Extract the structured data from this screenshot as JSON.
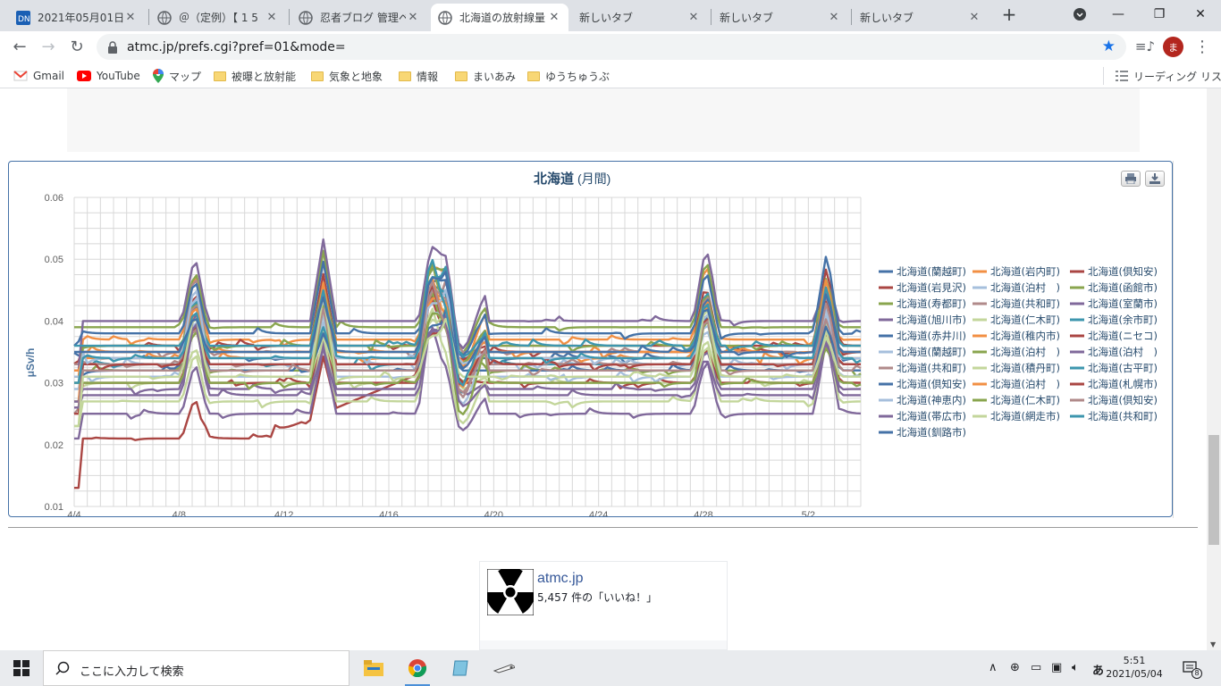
{
  "browser": {
    "tabs": [
      {
        "title": "2021年05月01日の",
        "favicon": "dn-icon",
        "active": false
      },
      {
        "title": "＠（定例）【 1 5",
        "favicon": "globe-icon",
        "active": false
      },
      {
        "title": "忍者ブログ 管理ペー",
        "favicon": "globe-icon",
        "active": false
      },
      {
        "title": "北海道の放射線量",
        "favicon": "globe-icon",
        "active": true
      },
      {
        "title": "新しいタブ",
        "favicon": "",
        "active": false
      },
      {
        "title": "新しいタブ",
        "favicon": "",
        "active": false
      },
      {
        "title": "新しいタブ",
        "favicon": "",
        "active": false
      }
    ],
    "new_tab_label": "+",
    "url": "atmc.jp/prefs.cgi?pref=01&mode=",
    "profile_initial": "ま",
    "bookmarks": [
      {
        "label": "Gmail",
        "icon": "gmail-icon"
      },
      {
        "label": "YouTube",
        "icon": "youtube-icon"
      },
      {
        "label": "マップ",
        "icon": "maps-icon"
      },
      {
        "label": "被曝と放射能",
        "icon": "folder-icon"
      },
      {
        "label": "気象と地象",
        "icon": "folder-icon"
      },
      {
        "label": "情報",
        "icon": "folder-icon"
      },
      {
        "label": "まいあみ",
        "icon": "folder-icon"
      },
      {
        "label": "ゆうちゅうぶ",
        "icon": "folder-icon"
      }
    ],
    "reading_list": "リーディング リスト"
  },
  "chart_data": {
    "type": "line",
    "title": "北海道",
    "subtitle": "(月間)",
    "ylabel": "μSv/h",
    "ylim": [
      0.01,
      0.06
    ],
    "yticks": [
      "0.06",
      "0.05",
      "0.04",
      "0.03",
      "0.02",
      "0.01"
    ],
    "xticks": [
      "4/4",
      "4/8",
      "4/12",
      "4/16",
      "4/20",
      "4/24",
      "4/28",
      "5/2"
    ],
    "x_range_days": [
      0,
      30
    ],
    "legend_placement": "right",
    "series": [
      {
        "name": "北海道(蘭越町)",
        "color": "#4572a7",
        "base": 0.034
      },
      {
        "name": "北海道(岩内町)",
        "color": "#f28f43",
        "base": 0.037
      },
      {
        "name": "北海道(倶知安)",
        "color": "#aa4643",
        "base": 0.036
      },
      {
        "name": "北海道(岩見沢)",
        "color": "#aa4643",
        "base": 0.021,
        "drift": 0.014
      },
      {
        "name": "北海道(泊村　)",
        "color": "#a6bfdc",
        "base": 0.033
      },
      {
        "name": "北海道(函館市)",
        "color": "#89a54e",
        "base": 0.039
      },
      {
        "name": "北海道(寿都町)",
        "color": "#89a54e",
        "base": 0.032
      },
      {
        "name": "北海道(共和町)",
        "color": "#b08a8a",
        "base": 0.035
      },
      {
        "name": "北海道(室蘭市)",
        "color": "#80699b",
        "base": 0.04
      },
      {
        "name": "北海道(旭川市)",
        "color": "#80699b",
        "base": 0.025
      },
      {
        "name": "北海道(仁木町)",
        "color": "#c3d69b",
        "base": 0.03
      },
      {
        "name": "北海道(余市町)",
        "color": "#3d96ae",
        "base": 0.033
      },
      {
        "name": "北海道(赤井川)",
        "color": "#4572a7",
        "base": 0.038
      },
      {
        "name": "北海道(稚内市)",
        "color": "#f28f43",
        "base": 0.035
      },
      {
        "name": "北海道(ニセコ)",
        "color": "#aa4643",
        "base": 0.03
      },
      {
        "name": "北海道(蘭越町)",
        "color": "#a6bfdc",
        "base": 0.031
      },
      {
        "name": "北海道(泊村　)",
        "color": "#89a54e",
        "base": 0.036
      },
      {
        "name": "北海道(泊村　)",
        "color": "#80699b",
        "base": 0.029
      },
      {
        "name": "北海道(共和町)",
        "color": "#b08a8a",
        "base": 0.033
      },
      {
        "name": "北海道(積丹町)",
        "color": "#c3d69b",
        "base": 0.027
      },
      {
        "name": "北海道(古平町)",
        "color": "#3d96ae",
        "base": 0.036
      },
      {
        "name": "北海道(倶知安)",
        "color": "#4572a7",
        "base": 0.032
      },
      {
        "name": "北海道(泊村　)",
        "color": "#f28f43",
        "base": 0.034
      },
      {
        "name": "北海道(札幌市)",
        "color": "#aa4643",
        "base": 0.033
      },
      {
        "name": "北海道(神恵内)",
        "color": "#a6bfdc",
        "base": 0.034
      },
      {
        "name": "北海道(仁木町)",
        "color": "#89a54e",
        "base": 0.03
      },
      {
        "name": "北海道(倶知安)",
        "color": "#b08a8a",
        "base": 0.032
      },
      {
        "name": "北海道(帯広市)",
        "color": "#80699b",
        "base": 0.028
      },
      {
        "name": "北海道(網走市)",
        "color": "#c3d69b",
        "base": 0.031
      },
      {
        "name": "北海道(共和町)",
        "color": "#3d96ae",
        "base": 0.034
      },
      {
        "name": "北海道(釧路市)",
        "color": "#4572a7",
        "base": 0.035
      }
    ]
  },
  "fb_widget": {
    "site": "atmc.jp",
    "likes": "5,457 件の「いいね！」",
    "icon": "radiation-icon"
  },
  "taskbar": {
    "search_placeholder": "ここに入力して検索",
    "time": "5:51",
    "date": "2021/05/04",
    "notification_count": "8",
    "ime_label": "あ"
  }
}
